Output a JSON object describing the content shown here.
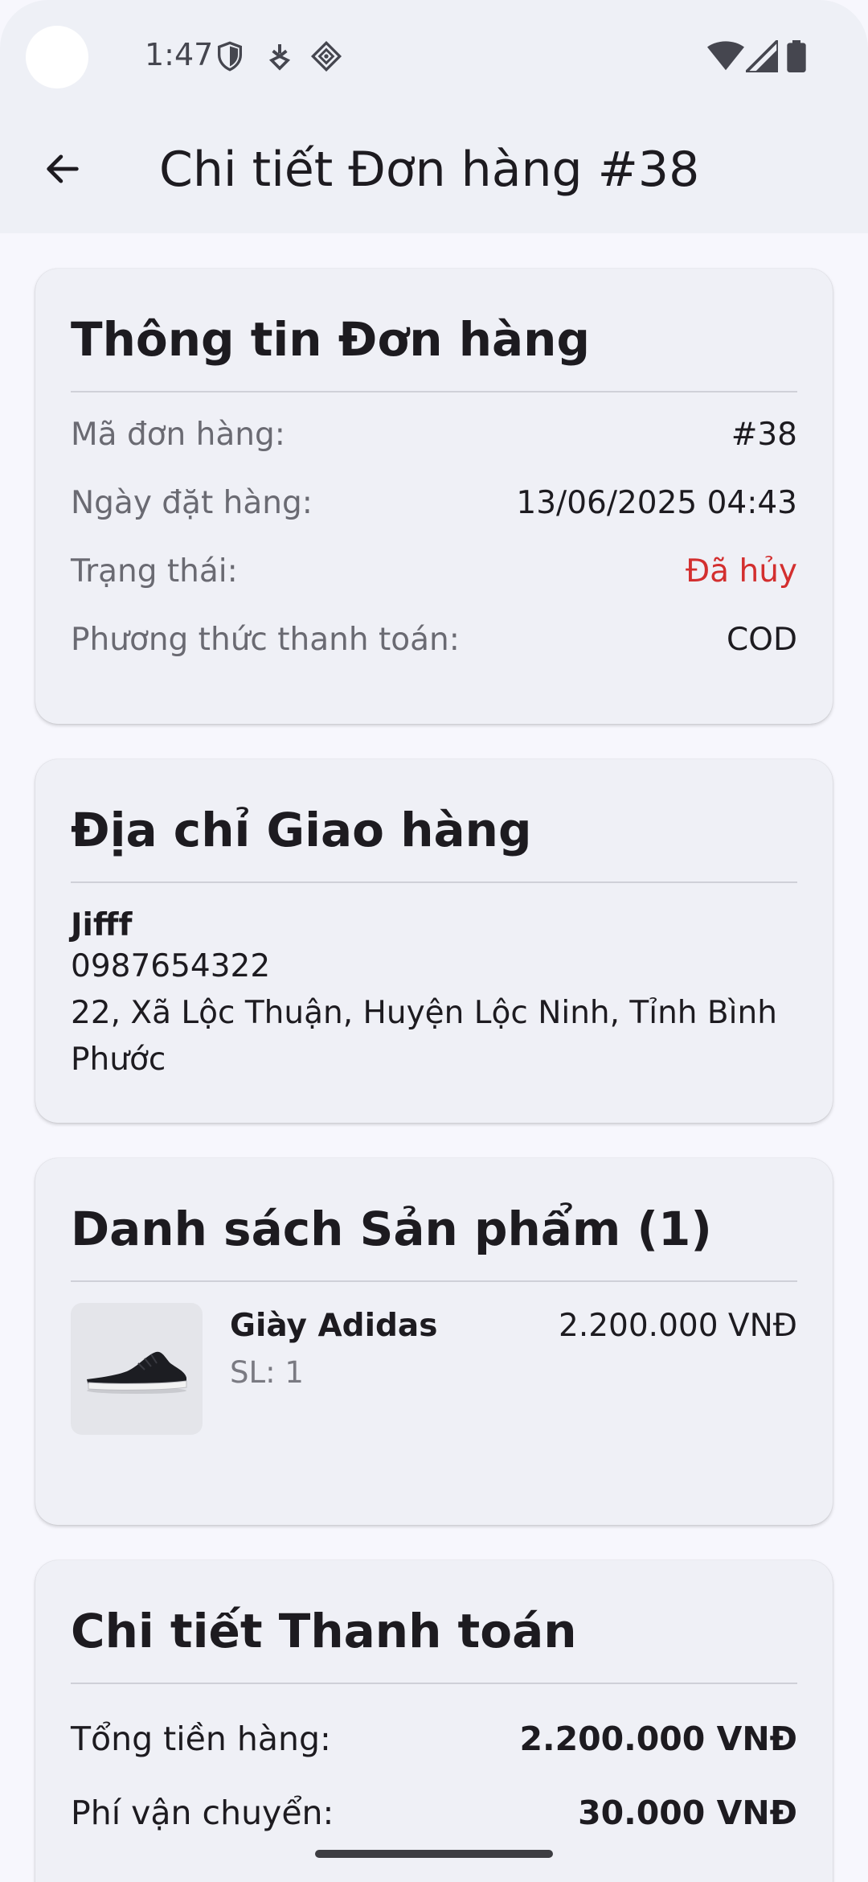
{
  "status_bar": {
    "time": "1:47"
  },
  "app_bar": {
    "title": "Chi tiết Đơn hàng #38"
  },
  "order_info": {
    "title": "Thông tin Đơn hàng",
    "rows": [
      {
        "label": "Mã đơn hàng:",
        "value": "#38"
      },
      {
        "label": "Ngày đặt hàng:",
        "value": "13/06/2025 04:43"
      },
      {
        "label": "Trạng thái:",
        "value": "Đã hủy"
      },
      {
        "label": "Phương thức thanh toán:",
        "value": "COD"
      }
    ]
  },
  "shipping": {
    "title": "Địa chỉ Giao hàng",
    "name": "Jifff",
    "phone": "0987654322",
    "address_line1": "22, Xã Lộc Thuận, Huyện Lộc Ninh, Tỉnh Bình",
    "address_line2": "Phước"
  },
  "products": {
    "title": "Danh sách Sản phẩm (1)",
    "items": [
      {
        "name": "Giày Adidas",
        "qty": "SL: 1",
        "price": "2.200.000  VNĐ"
      }
    ]
  },
  "payment": {
    "title": "Chi tiết Thanh toán",
    "rows": [
      {
        "label": "Tổng tiền hàng:",
        "value": "2.200.000  VNĐ"
      },
      {
        "label": "Phí vận chuyển:",
        "value": "30.000  VNĐ"
      }
    ]
  },
  "colors": {
    "status_cancelled": "#d32f2f",
    "card_background": "#eff0f6",
    "app_bar_background": "#eef0f6"
  }
}
